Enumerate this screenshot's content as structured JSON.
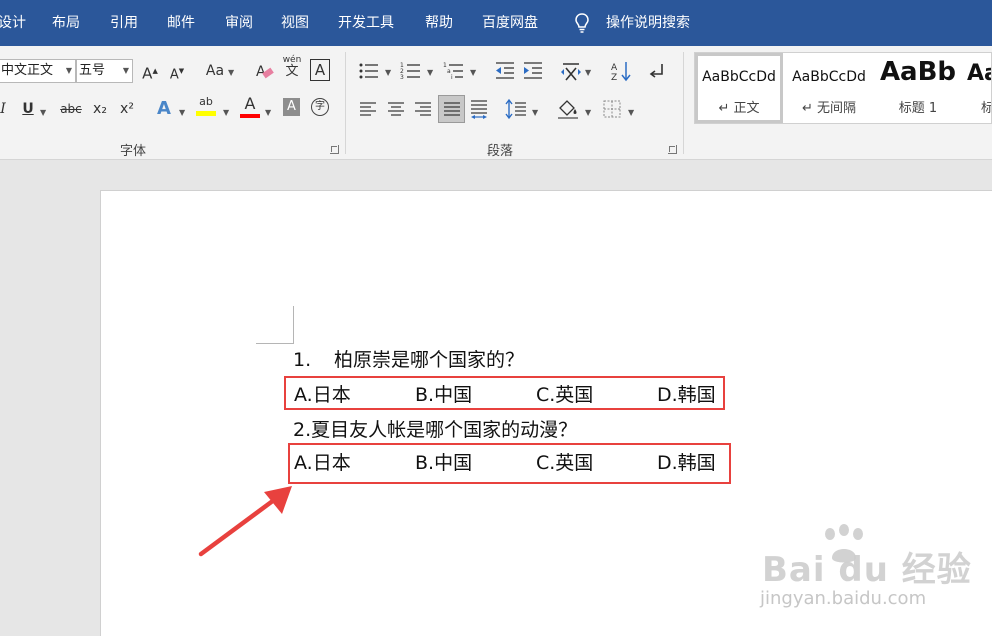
{
  "menu": {
    "tabs": [
      "设计",
      "布局",
      "引用",
      "邮件",
      "审阅",
      "视图",
      "开发工具",
      "帮助",
      "百度网盘"
    ],
    "tell_me": "操作说明搜索"
  },
  "font_group": {
    "font_name": "中文正文",
    "font_size": "五号",
    "grow_label": "A",
    "shrink_label": "A",
    "case_label": "Aa",
    "phonetic_top": "wén",
    "phonetic_bottom": "文",
    "border_char_label": "A",
    "italic_label": "I",
    "underline_label": "U",
    "strike_label": "abc",
    "subscript_label": "x₂",
    "superscript_label": "x²",
    "effects_label": "A",
    "highlight_label": "ab",
    "font_color_label": "A",
    "shading_label": "A",
    "enclose_label": "字",
    "label": "字体"
  },
  "paragraph_group": {
    "label": "段落"
  },
  "styles": [
    {
      "sample": "AaBbCcDd",
      "name": "↵ 正文"
    },
    {
      "sample": "AaBbCcDd",
      "name": "↵ 无间隔"
    },
    {
      "sample": "AaBb",
      "name": "标题 1"
    },
    {
      "sample": "Aa",
      "name": "标"
    }
  ],
  "document": {
    "q1_number": "1.",
    "q1_text": "柏原崇是哪个国家的？",
    "q2_text": "2.夏目友人帐是哪个国家的动漫？",
    "q1_options": [
      "A.日本",
      "B.中国",
      "C.英国",
      "D.韩国"
    ],
    "q2_options": [
      "A.日本",
      "B.中国",
      "C.英国",
      "D.韩国"
    ]
  },
  "watermark": {
    "logo": "Bai du 经验",
    "url": "jingyan.baidu.com"
  },
  "colors": {
    "menubar": "#2b579a",
    "highlight_box": "#e8413e",
    "arrow": "#e8413e",
    "text_highlight": "#ffff00",
    "font_color": "#ff0000"
  }
}
